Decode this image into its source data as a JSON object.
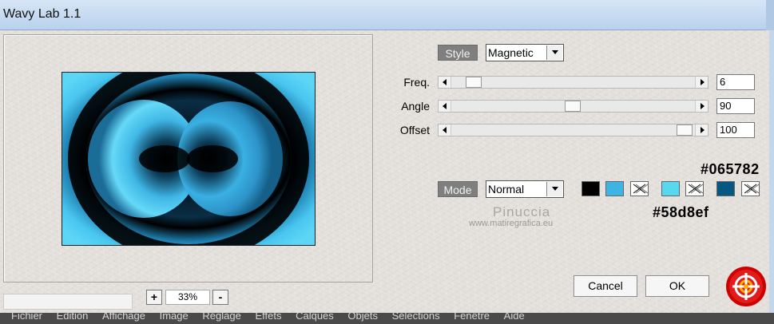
{
  "window": {
    "title": "Wavy Lab 1.1"
  },
  "preview": {
    "zoom_minus": "-",
    "zoom_plus": "+",
    "zoom_value": "33%"
  },
  "style": {
    "label": "Style",
    "value": "Magnetic"
  },
  "sliders": [
    {
      "name": "freq",
      "label": "Freq.",
      "value": "6"
    },
    {
      "name": "angle",
      "label": "Angle",
      "value": "90"
    },
    {
      "name": "offset",
      "label": "Offset",
      "value": "100"
    }
  ],
  "mode": {
    "label": "Mode",
    "value": "Normal"
  },
  "colors": {
    "swatch1": "#000000",
    "swatch2": "#3db4e4",
    "swatch3": "#58d8ef",
    "swatch4": "#065782",
    "annotation_top": "#065782",
    "annotation_bottom": "#58d8ef"
  },
  "watermark": {
    "name": "Pinuccia",
    "url": "www.matiregrafica.eu"
  },
  "buttons": {
    "cancel": "Cancel",
    "ok": "OK"
  },
  "menu": [
    "Fichier",
    "Édition",
    "Affichage",
    "Image",
    "Réglage",
    "Effets",
    "Calques",
    "Objets",
    "Sélections",
    "Fenêtre",
    "Aide"
  ]
}
